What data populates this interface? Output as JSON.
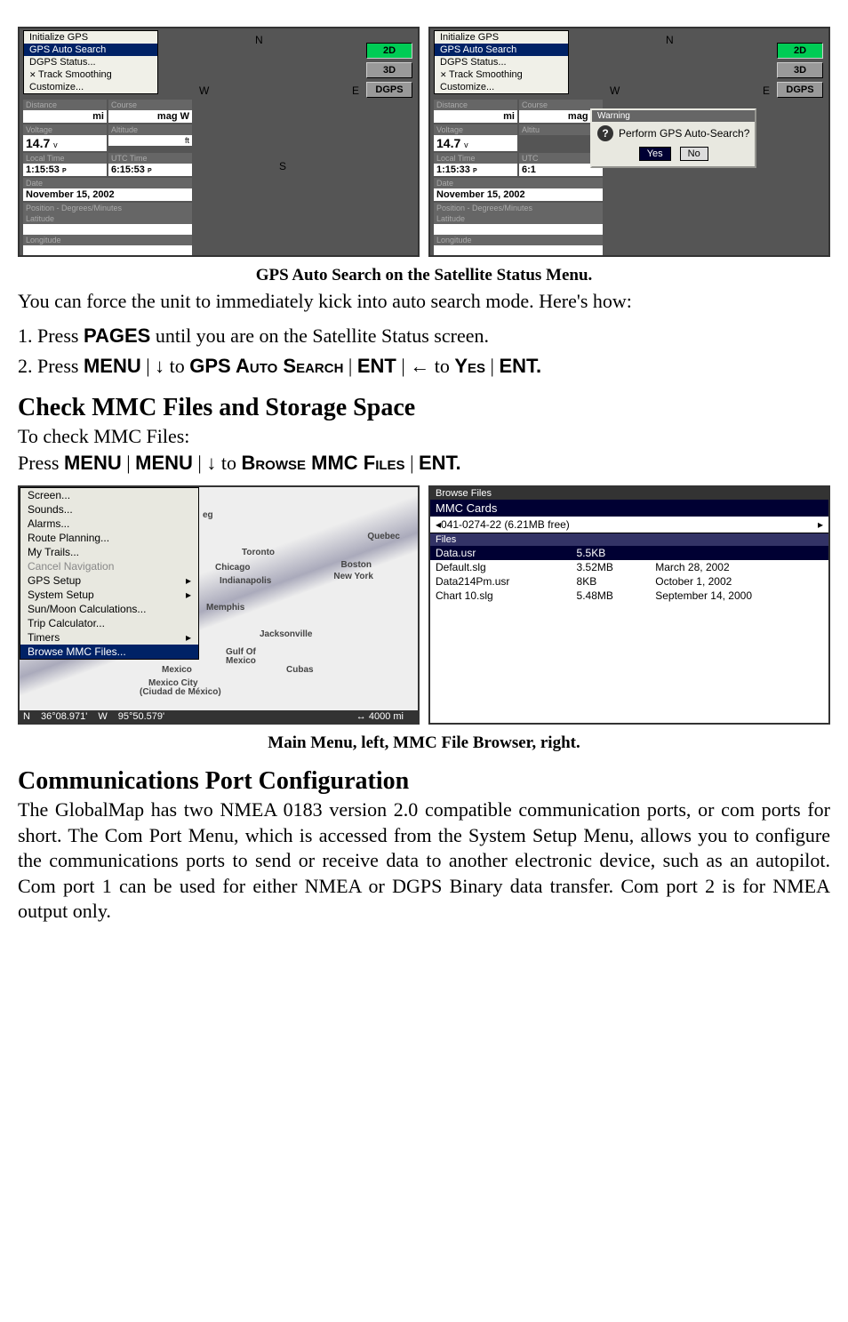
{
  "gps_menu": {
    "initialize": "Initialize GPS",
    "auto_search": "GPS Auto Search",
    "dgps_status": "DGPS Status...",
    "track_smoothing": "Track Smoothing",
    "customize": "Customize..."
  },
  "gps_buttons": {
    "b2d": "2D",
    "b3d": "3D",
    "dgps": "DGPS"
  },
  "gps_panel": {
    "distance_label": "Distance",
    "distance_unit": "mi",
    "course_label": "Course",
    "course_unit": "mag",
    "voltage_label": "Voltage",
    "voltage_value": "14.7",
    "voltage_unit": "v",
    "altitude_label": "Altitude",
    "altitude_unit": "ft",
    "local_time_label": "Local Time",
    "local_time_value": "1:15:53",
    "utc_time_label": "UTC Time",
    "utc_time_value": "6:15:53",
    "pm": "P",
    "m": "M",
    "date_label": "Date",
    "date_value": "November 15, 2002",
    "position_label": "Position - Degrees/Minutes",
    "latitude_label": "Latitude",
    "longitude_label": "Longitude",
    "local_time_value2": "1:15:33",
    "utc_time_value2": "6:1",
    "altitude_label2": "Altitu"
  },
  "compass": {
    "n": "N",
    "e": "E",
    "s": "S",
    "w": "W",
    "mag_w": "W"
  },
  "dialog": {
    "title": "Warning",
    "text": "Perform GPS Auto-Search?",
    "yes": "Yes",
    "no": "No"
  },
  "caption1": "GPS Auto Search on the Satellite Status Menu.",
  "body1": "You can force the unit to immediately kick into auto search mode. Here's how:",
  "step1a": "1. Press ",
  "step1b": "PAGES",
  "step1c": " until you are on the Satellite Status screen.",
  "step2a": "2. Press ",
  "step2_menu": "MENU",
  "step2_to1": " to ",
  "step2_gas": "GPS Auto Search",
  "step2_ent": "ENT",
  "step2_to2": " to ",
  "step2_yes": "Yes",
  "step2_ent2": "ENT.",
  "heading1": "Check MMC Files and Storage Space",
  "body2a": "To check MMC Files:",
  "body2b_press": "Press ",
  "body2b_menu": "MENU",
  "body2b_to": " to ",
  "body2b_browse": "Browse MMC Files",
  "body2b_ent": "ENT.",
  "main_menu": {
    "screen": "Screen...",
    "sounds": "Sounds...",
    "alarms": "Alarms...",
    "route": "Route Planning...",
    "trails": "My Trails...",
    "cancel_nav": "Cancel Navigation",
    "gps_setup": "GPS Setup",
    "system_setup": "System Setup",
    "sunmoon": "Sun/Moon Calculations...",
    "trip": "Trip Calculator...",
    "timers": "Timers",
    "browse": "Browse MMC Files..."
  },
  "map_labels": {
    "quebec": "Quebec",
    "toronto": "Toronto",
    "chicago": "Chicago",
    "boston": "Boston",
    "newyork": "New York",
    "indianapolis": "Indianapolis",
    "memphis": "Memphis",
    "jacksonville": "Jacksonville",
    "gulf": "Gulf Of",
    "mexico2": "Mexico",
    "mexico": "Mexico",
    "mexico_city": "Mexico City",
    "ciudad": "(Ciudad de México)",
    "cubas": "Cubas",
    "eg": "eg"
  },
  "status_bar": {
    "n": "N",
    "lat": "36°08.971'",
    "w": "W",
    "lon": "95°50.579'",
    "scale": "↔ 4000 mi"
  },
  "browse": {
    "title": "Browse Files",
    "mmc_cards": "MMC Cards",
    "card_name": "041-0274-22  (6.21MB free)",
    "files_header": "Files",
    "files": [
      {
        "name": "Data.usr",
        "size": "5.5KB",
        "date": ""
      },
      {
        "name": "Default.slg",
        "size": "3.52MB",
        "date": "March 28, 2002"
      },
      {
        "name": "Data214Pm.usr",
        "size": "8KB",
        "date": "October 1, 2002"
      },
      {
        "name": "Chart 10.slg",
        "size": "5.48MB",
        "date": "September 14, 2000"
      }
    ]
  },
  "caption2": "Main Menu, left, MMC File Browser, right.",
  "heading2": "Communications Port Configuration",
  "body3": "The GlobalMap has two NMEA 0183 version 2.0 compatible communication ports, or com ports for short. The Com Port Menu, which is accessed from the System Setup Menu, allows you to configure the communications ports to send or receive data to another electronic device, such as an autopilot. Com port 1 can be used for either NMEA or DGPS Binary data transfer. Com port 2 is for NMEA output only."
}
